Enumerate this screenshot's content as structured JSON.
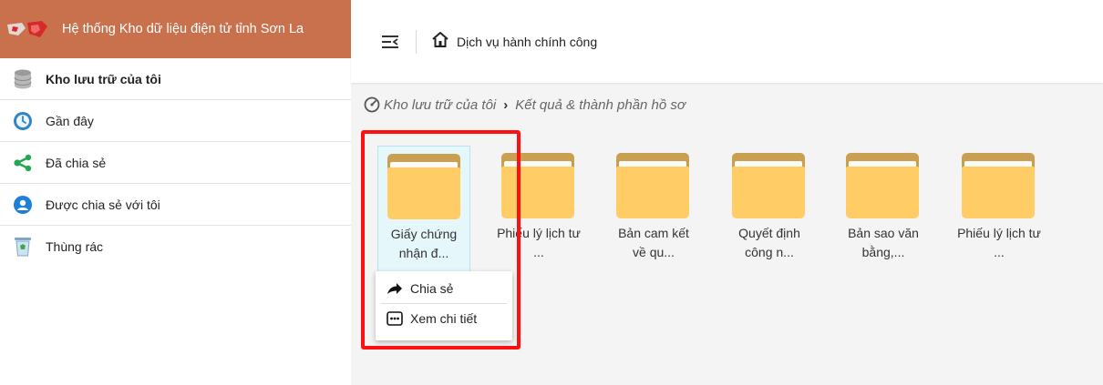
{
  "sidebar": {
    "brand_title": "Hệ thống Kho dữ liệu điện tử tỉnh Sơn La",
    "items": [
      {
        "label": "Kho lưu trữ của tôi",
        "icon": "database-icon",
        "active": true
      },
      {
        "label": "Gần đây",
        "icon": "clock-icon"
      },
      {
        "label": "Đã chia sẻ",
        "icon": "share-icon"
      },
      {
        "label": "Được chia sẻ với tôi",
        "icon": "shared-with-me-icon"
      },
      {
        "label": "Thùng rác",
        "icon": "trash-icon"
      }
    ]
  },
  "topbar": {
    "home_label": "Dịch vụ hành chính công"
  },
  "breadcrumb": {
    "items": [
      "Kho lưu trữ của tôi",
      "Kết quả & thành phần hồ sơ"
    ]
  },
  "folders": [
    {
      "name": "Giấy chứng nhận đ..."
    },
    {
      "name": "Phiếu lý lịch tư ..."
    },
    {
      "name": "Bản cam kết về qu..."
    },
    {
      "name": "Quyết định công n..."
    },
    {
      "name": "Bản sao văn bằng,..."
    },
    {
      "name": "Phiếu lý lịch tư ..."
    }
  ],
  "context_menu": {
    "items": [
      {
        "label": "Chia sẻ",
        "icon": "arrow-share-icon"
      },
      {
        "label": "Xem chi tiết",
        "icon": "more-details-icon"
      }
    ]
  },
  "colors": {
    "brand": "#c9714d",
    "folder": "#ffcc66",
    "folder_tab": "#c9a052",
    "highlight": "#ff1010",
    "selected_bg": "#e6f7fb"
  }
}
